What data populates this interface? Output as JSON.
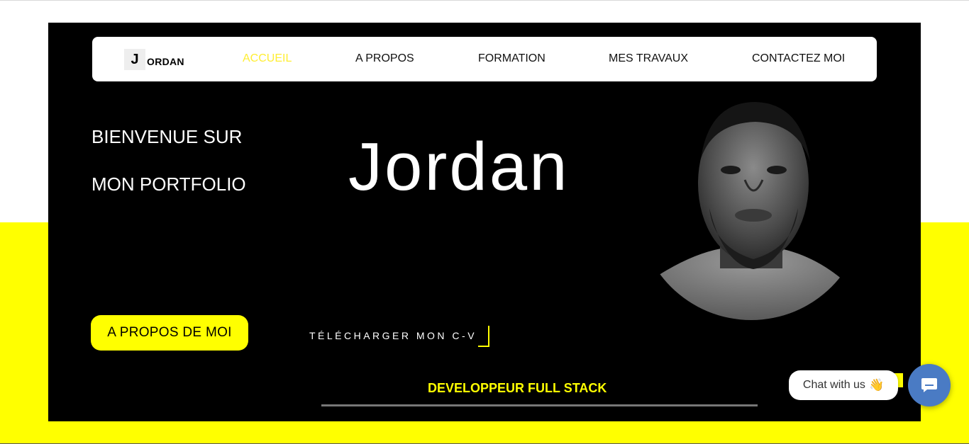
{
  "nav": {
    "logo_mark": "J",
    "logo_text": "ORDAN",
    "items": [
      {
        "label": "ACCUEIL",
        "active": true
      },
      {
        "label": "A PROPOS"
      },
      {
        "label": "FORMATION"
      },
      {
        "label": "MES TRAVAUX"
      },
      {
        "label": "CONTACTEZ MOI"
      }
    ]
  },
  "hero": {
    "welcome_line1": "BIENVENUE SUR",
    "welcome_line2": "MON PORTFOLIO",
    "name": "Jordan",
    "about_button": "A PROPOS DE MOI",
    "cv_button": "TÉLÉCHARGER MON C-V",
    "role": "DEVELOPPEUR FULL STACK"
  },
  "chat": {
    "bubble_text": "Chat with us",
    "bubble_emoji": "👋",
    "button_icon": "chat-icon"
  },
  "colors": {
    "accent": "#ffff00",
    "hero_bg": "#000000",
    "chat_button": "#4a7bc4"
  }
}
